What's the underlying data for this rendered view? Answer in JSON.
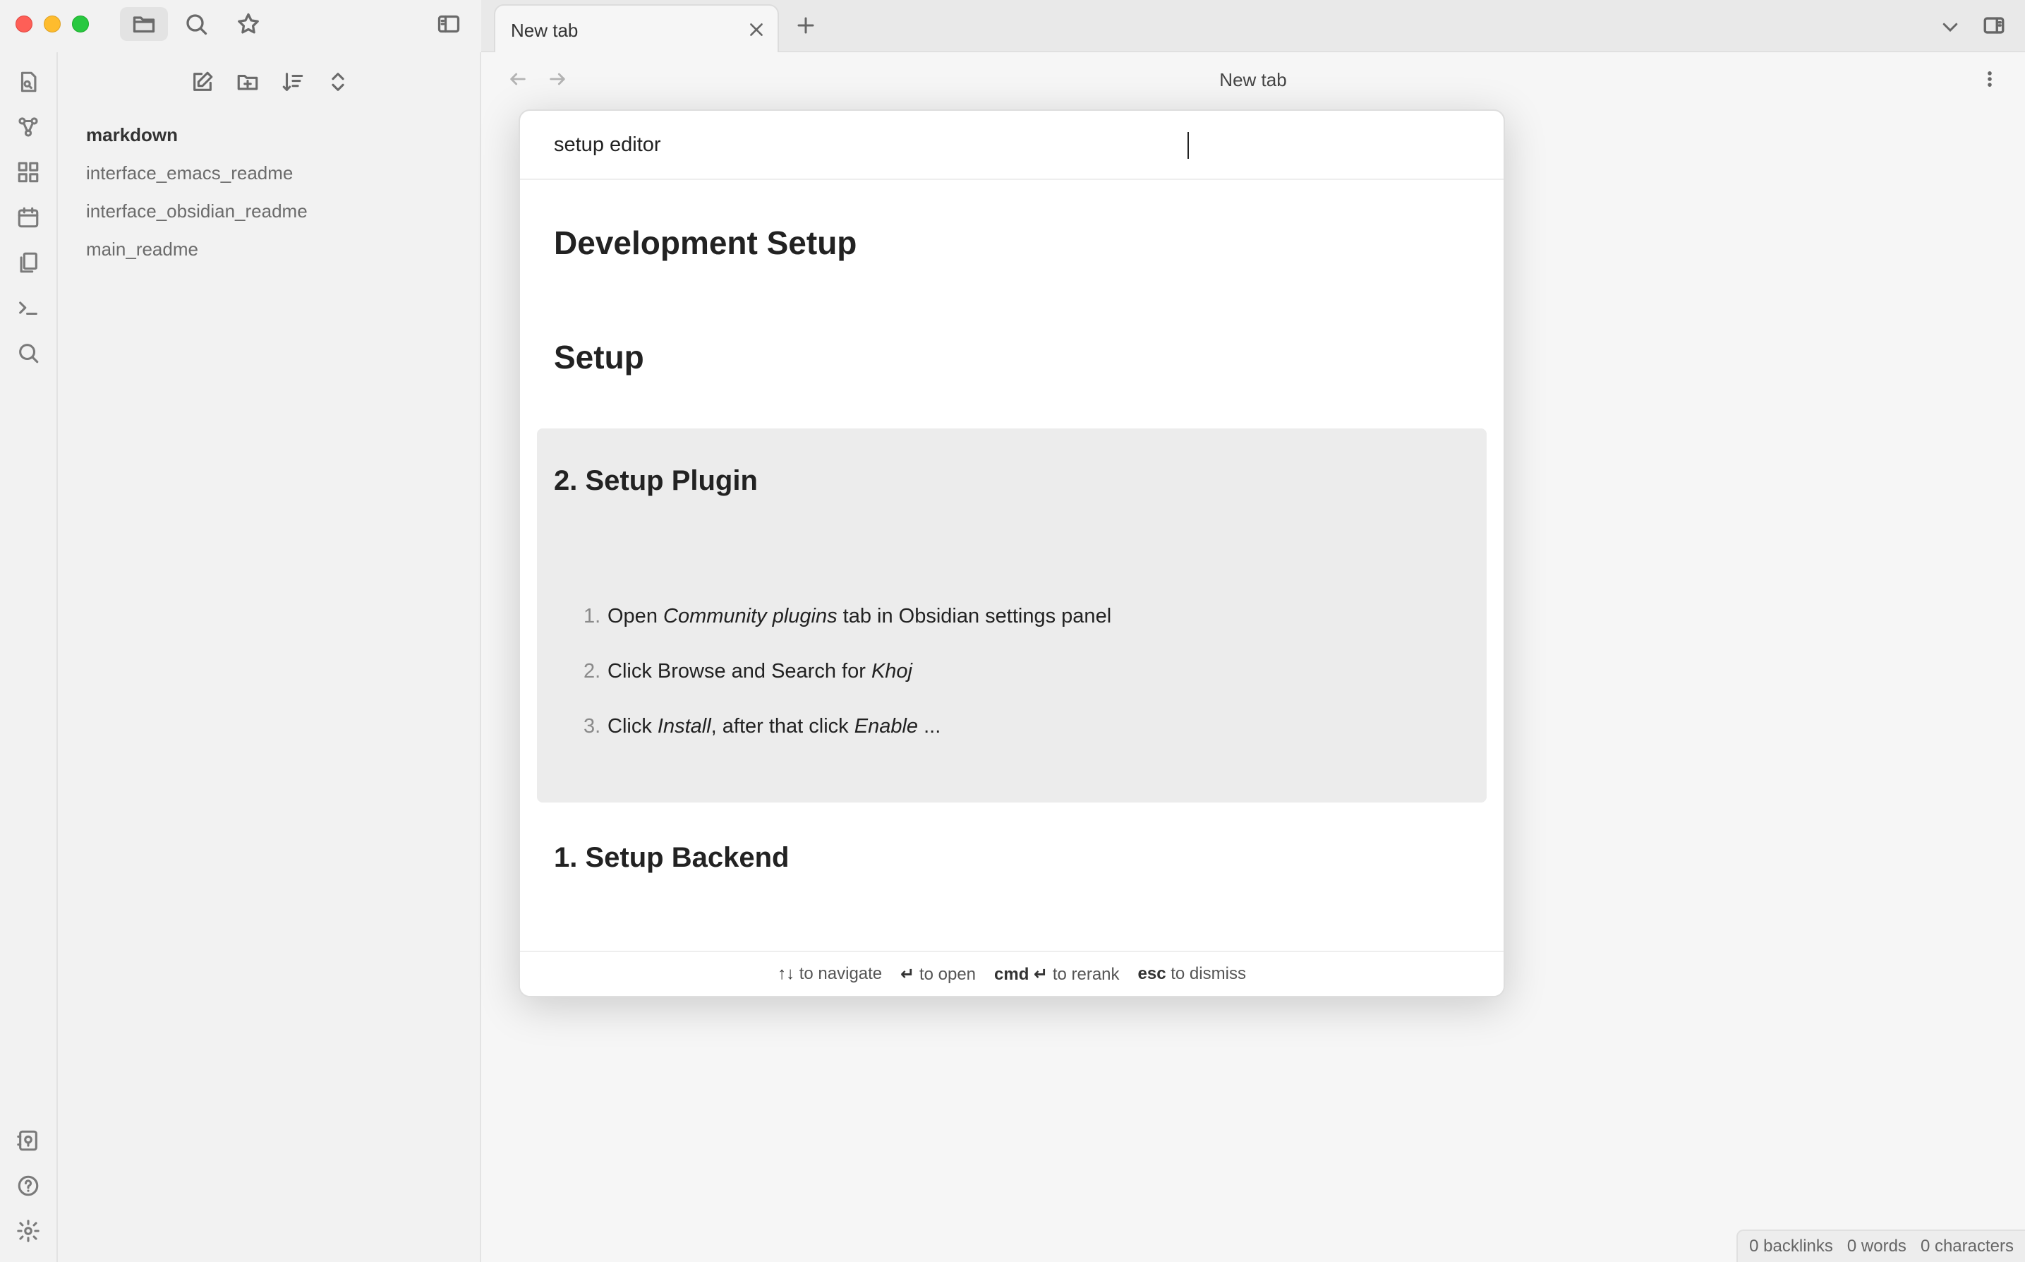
{
  "window": {
    "traffic_colors": {
      "close": "#fe5f57",
      "minimize": "#febc2e",
      "zoom": "#28c840"
    }
  },
  "titlebar": {
    "icons": [
      "folder-icon",
      "search-icon",
      "star-icon",
      "sidebar-toggle-icon"
    ]
  },
  "ribbon": {
    "icons": [
      "quick-switcher-icon",
      "graph-icon",
      "canvas-icon",
      "calendar-icon",
      "templates-icon",
      "terminal-icon",
      "search-icon",
      "vault-icon",
      "help-icon",
      "settings-icon"
    ]
  },
  "sidebar": {
    "actions": [
      "new-note-icon",
      "new-folder-icon",
      "sort-icon",
      "collapse-icon"
    ],
    "tree": [
      {
        "label": "markdown",
        "type": "folder"
      },
      {
        "label": "interface_emacs_readme",
        "type": "file"
      },
      {
        "label": "interface_obsidian_readme",
        "type": "file"
      },
      {
        "label": "main_readme",
        "type": "file"
      }
    ]
  },
  "tabs": {
    "active": {
      "title": "New tab"
    }
  },
  "navbar": {
    "title": "New tab"
  },
  "modal": {
    "query": "setup editor",
    "results": [
      {
        "heading": "Development Setup"
      },
      {
        "heading": "Setup"
      },
      {
        "heading": "2. Setup Plugin",
        "steps": [
          {
            "num": "1.",
            "parts": [
              "Open ",
              "Community plugins",
              " tab in Obsidian settings panel"
            ]
          },
          {
            "num": "2.",
            "parts": [
              "Click Browse and Search for ",
              "Khoj",
              ""
            ]
          },
          {
            "num": "3.",
            "parts": [
              "Click ",
              "Install",
              ", after that click ",
              "Enable",
              " ..."
            ]
          }
        ]
      },
      {
        "heading": "1. Setup Backend"
      }
    ],
    "footer": [
      {
        "key": "↑↓",
        "text": "to navigate"
      },
      {
        "key": "↵",
        "text": "to open"
      },
      {
        "key": "cmd ↵",
        "text": "to rerank"
      },
      {
        "key": "esc",
        "text": "to dismiss"
      }
    ]
  },
  "statusbar": {
    "backlinks": "0 backlinks",
    "words": "0 words",
    "characters": "0 characters"
  }
}
